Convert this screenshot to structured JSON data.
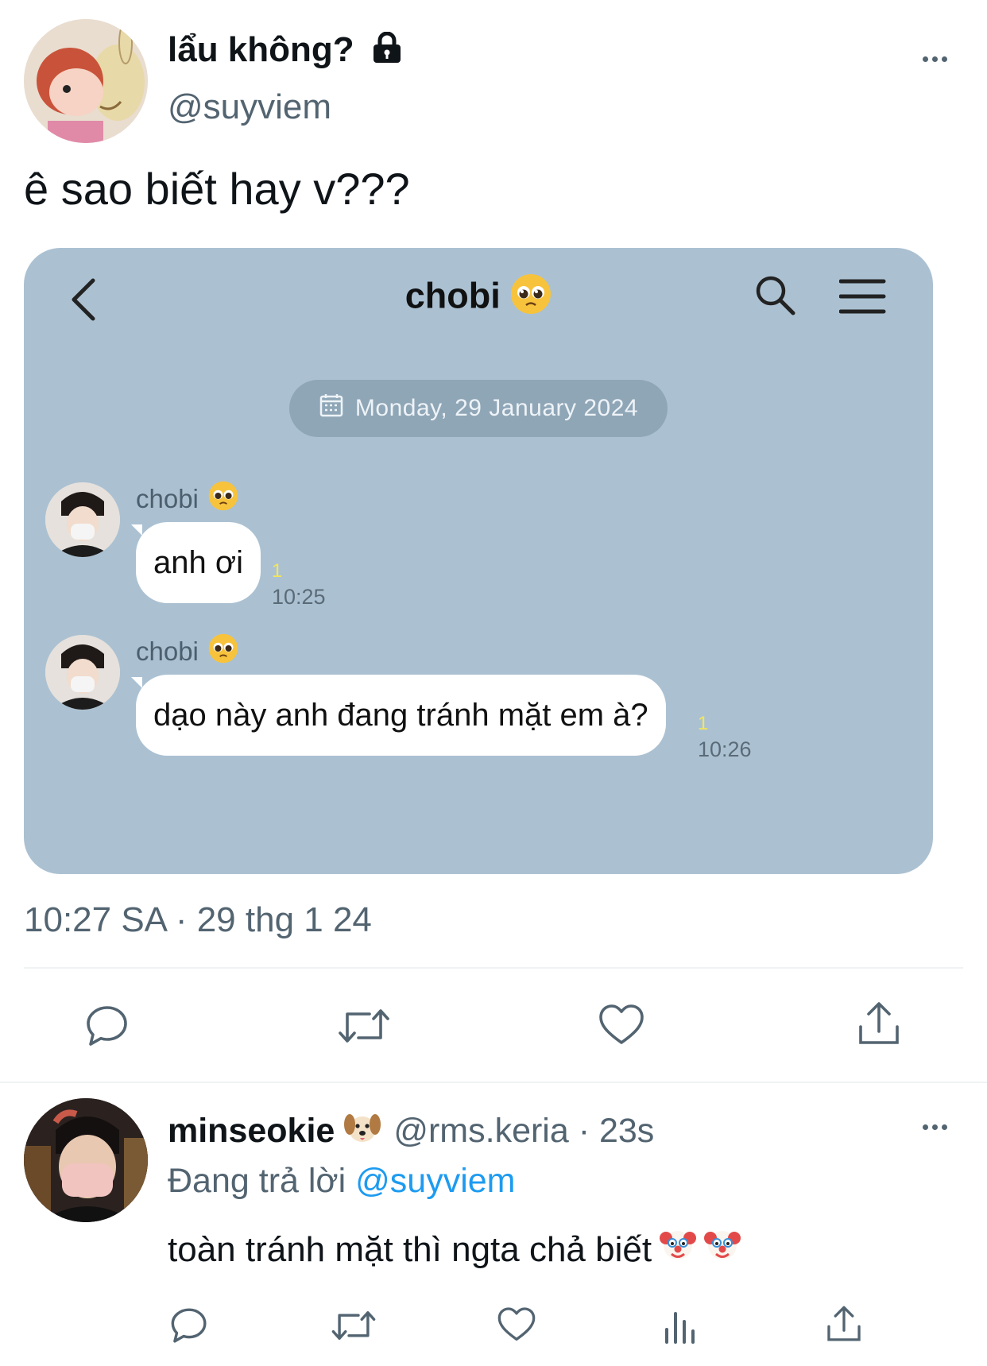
{
  "tweet": {
    "display_name": "lẩu không?",
    "handle": "@suyviem",
    "text": "ê sao biết hay v???",
    "meta": "10:27 SA · 29 thg 1 24",
    "icons": [
      "lock-icon",
      "more-icon"
    ]
  },
  "chat": {
    "title": "chobi",
    "date": "Monday, 29 January 2024",
    "messages": [
      {
        "sender": "chobi",
        "text": "anh ơi",
        "unread": "1",
        "time": "10:25"
      },
      {
        "sender": "chobi",
        "text": "dạo này anh đang tránh mặt em à?",
        "unread": "1",
        "time": "10:26"
      }
    ],
    "colors": {
      "background": "#abc1d2",
      "date_pill": "#8fa6b7",
      "unread": "#f4e55a"
    }
  },
  "actions": [
    "reply-icon",
    "retweet-icon",
    "like-icon",
    "share-icon"
  ],
  "reply": {
    "display_name": "minseokie",
    "handle_time": "@rms.keria · 23s",
    "replying_label": "Đang trả lời",
    "replying_to": "@suyviem",
    "text": "toàn tránh mặt thì ngta chả biết",
    "actions": [
      "reply-icon",
      "retweet-icon",
      "like-icon",
      "views-icon",
      "share-icon"
    ],
    "colors": {
      "mention": "#1d9bf0"
    }
  }
}
